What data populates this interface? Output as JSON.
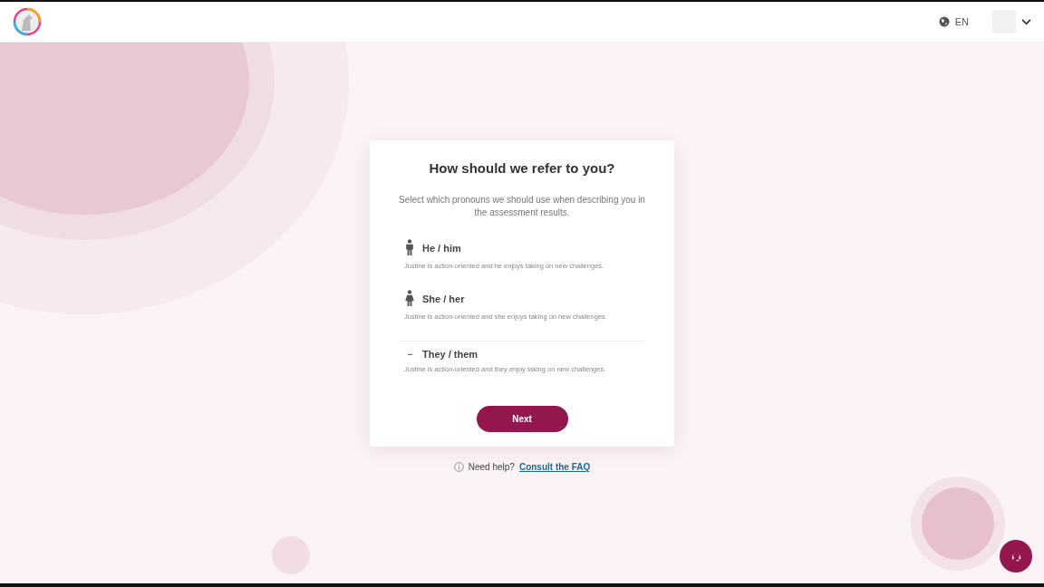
{
  "header": {
    "language": "EN"
  },
  "card": {
    "title": "How should we refer to you?",
    "intro": "Select which pronouns we should use when describing you in the assessment results.",
    "options": [
      {
        "kind": "male",
        "label": "He / him",
        "example": "Justine is action-oriented and he enjoys taking on new challenges."
      },
      {
        "kind": "female",
        "label": "She / her",
        "example": "Justine is action-oriented and she enjoys taking on new challenges."
      },
      {
        "kind": "neutral",
        "label": "They / them",
        "example": "Justine is action-oriented and they enjoy taking on new challenges."
      }
    ],
    "button": "Next"
  },
  "help": {
    "text": "Need help?",
    "link": "Consult the FAQ"
  }
}
